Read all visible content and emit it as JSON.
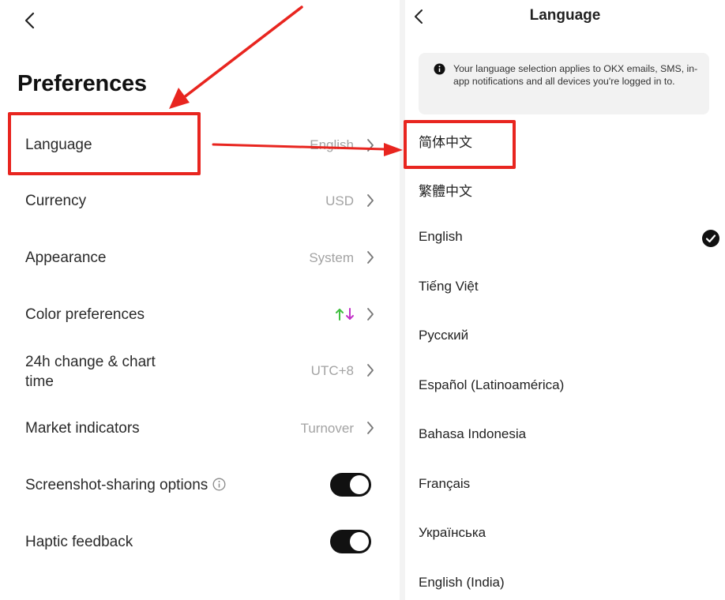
{
  "left": {
    "title": "Preferences",
    "rows": [
      {
        "label": "Language",
        "value": "English"
      },
      {
        "label": "Currency",
        "value": "USD"
      },
      {
        "label": "Appearance",
        "value": "System"
      },
      {
        "label": "Color preferences",
        "value": ""
      },
      {
        "label_line1": "24h change & chart",
        "label_line2": "time",
        "value": "UTC+8"
      },
      {
        "label": "Market indicators",
        "value": "Turnover"
      },
      {
        "label": "Screenshot-sharing options",
        "toggle_on": true
      },
      {
        "label": "Haptic feedback",
        "toggle_on": true
      }
    ],
    "color_pref_up_color": "#3fbf3f",
    "color_pref_down_color": "#c233c8"
  },
  "right": {
    "title": "Language",
    "notice": "Your language selection applies to OKX emails, SMS, in-app notifications and all devices you're logged in to.",
    "languages": [
      "简体中文",
      "繁體中文",
      "English",
      "Tiếng Việt",
      "Русский",
      "Español (Latinoamérica)",
      "Bahasa Indonesia",
      "Français",
      "Українська",
      "English (India)"
    ],
    "selected_language": "English"
  },
  "annotation_color": "#e8251f",
  "icons": [
    "back-icon",
    "chevron-right-icon",
    "info-icon",
    "check-icon",
    "arrow-up-icon",
    "arrow-down-icon"
  ]
}
